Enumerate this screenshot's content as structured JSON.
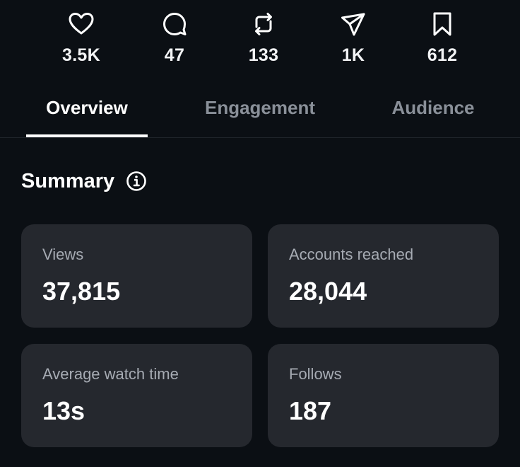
{
  "stats": [
    {
      "icon": "heart-icon",
      "count": "3.5K"
    },
    {
      "icon": "comment-icon",
      "count": "47"
    },
    {
      "icon": "repost-icon",
      "count": "133"
    },
    {
      "icon": "share-icon",
      "count": "1K"
    },
    {
      "icon": "bookmark-icon",
      "count": "612"
    }
  ],
  "tabs": [
    {
      "label": "Overview",
      "active": true
    },
    {
      "label": "Engagement",
      "active": false
    },
    {
      "label": "Audience",
      "active": false
    }
  ],
  "summary": {
    "title": "Summary",
    "info_icon": "info-icon",
    "cards": [
      {
        "label": "Views",
        "value": "37,815"
      },
      {
        "label": "Accounts reached",
        "value": "28,044"
      },
      {
        "label": "Average watch time",
        "value": "13s"
      },
      {
        "label": "Follows",
        "value": "187"
      }
    ]
  },
  "colors": {
    "background": "#0b0f14",
    "card": "#25282e",
    "text_primary": "#ffffff",
    "text_secondary": "#a6abb3",
    "tab_inactive": "#8a9099"
  }
}
